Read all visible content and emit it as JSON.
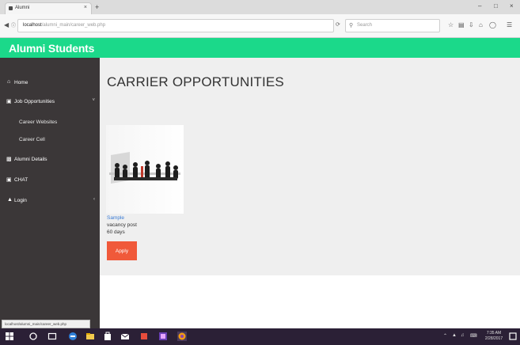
{
  "browser": {
    "tab_title": "Alumni",
    "tab_close": "×",
    "new_tab": "+",
    "minimize": "–",
    "maximize": "□",
    "close": "×",
    "url_host": "localhost",
    "url_path": "/alumni_main/career_web.php",
    "search_placeholder": "Search"
  },
  "header": {
    "brand": "Alumni Students"
  },
  "sidebar": {
    "items": [
      {
        "icon": "home-icon",
        "label": "Home"
      },
      {
        "icon": "book-icon",
        "label": "Job Opportunities",
        "caret": "˅"
      },
      {
        "label": "Career Websites"
      },
      {
        "label": "Career Cell"
      },
      {
        "icon": "id-card-icon",
        "label": "Alumni Details"
      },
      {
        "icon": "chat-icon",
        "label": "CHAT"
      },
      {
        "icon": "user-icon",
        "label": "Login",
        "caret": "‹"
      }
    ]
  },
  "status_url": "localhost/alumni_main/career_web.php",
  "main": {
    "title": "CARRIER OPPORTUNITIES",
    "card": {
      "name": "Sample",
      "description": "vacancy post",
      "days": "60 days",
      "apply_label": "Apply"
    }
  },
  "taskbar": {
    "clock_time": "7:35 AM",
    "clock_date": "2/28/2017"
  },
  "colors": {
    "header": "#1bd98a",
    "sidebar": "#3b3738",
    "apply": "#f0593a",
    "link": "#3a7bd5"
  }
}
